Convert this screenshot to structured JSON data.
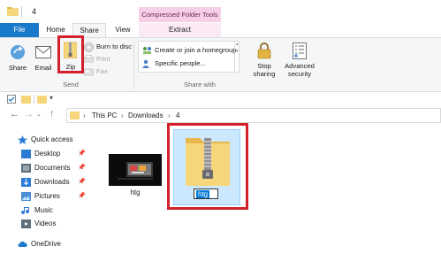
{
  "window": {
    "title": "4"
  },
  "tabs": {
    "file": "File",
    "home": "Home",
    "share": "Share",
    "view": "View",
    "contextual_header": "Compressed Folder Tools",
    "extract": "Extract"
  },
  "ribbon": {
    "send": {
      "share": "Share",
      "email": "Email",
      "zip": "Zip",
      "burn": "Burn to disc",
      "print": "Print",
      "fax": "Fax",
      "group_label": "Send"
    },
    "share_with": {
      "items": [
        "Create or join a homegroup",
        "Specific people..."
      ],
      "group_label": "Share with"
    },
    "stop_sharing": [
      "Stop",
      "sharing"
    ],
    "advanced_security": [
      "Advanced",
      "security"
    ]
  },
  "address": {
    "crumbs": [
      "This PC",
      "Downloads",
      "4"
    ]
  },
  "nav_pane": {
    "quick_access": "Quick access",
    "items": [
      "Desktop",
      "Documents",
      "Downloads",
      "Pictures",
      "Music",
      "Videos"
    ],
    "onedrive": "OneDrive"
  },
  "files": [
    {
      "name": "htg",
      "type": "image"
    },
    {
      "name": "htg",
      "type": "zip-folder",
      "renaming": true
    }
  ],
  "colors": {
    "file_tab": "#1979ca",
    "contextual_tab": "#f6cfe6",
    "selection": "#cce8ff",
    "highlight_box": "#d3202c",
    "folder": "#f6d67a"
  }
}
